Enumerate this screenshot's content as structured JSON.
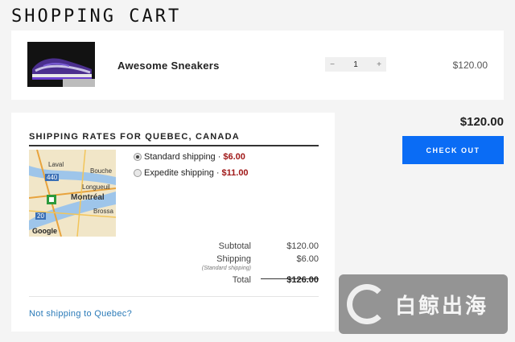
{
  "page": {
    "title": "SHOPPING CART"
  },
  "cart": {
    "items": [
      {
        "name": "Awesome Sneakers",
        "quantity": "1",
        "price": "$120.00",
        "thumbnail": "sneaker-image"
      }
    ],
    "qty_minus": "−",
    "qty_plus": "+"
  },
  "shipping": {
    "title": "SHIPPING RATES FOR QUEBEC, CANADA",
    "map_labels": {
      "laval": "Laval",
      "boucherville": "Bouche",
      "longueuil": "Longueuil",
      "montreal": "Montréal",
      "brossard": "Brossa",
      "route_440": "440",
      "route_20": "20",
      "google": "Google"
    },
    "options": [
      {
        "label": "Standard shipping",
        "sep": " · ",
        "price": "$6.00",
        "selected": true
      },
      {
        "label": "Expedite shipping",
        "sep": " · ",
        "price": "$11.00",
        "selected": false
      }
    ]
  },
  "summary": {
    "subtotal_label": "Subtotal",
    "subtotal": "$120.00",
    "shipping_label": "Shipping",
    "shipping": "$6.00",
    "shipping_note": "(Standard shipping)",
    "total_label": "Total",
    "total": "$126.00"
  },
  "not_shipping_link": "Not shipping to Quebec?",
  "grand_total": "$120.00",
  "checkout_label": "CHECK OUT",
  "watermark": {
    "text": "白鲸出海"
  },
  "colors": {
    "accent": "#0a6cf5",
    "price_red": "#a01818",
    "link": "#2a7ab8"
  }
}
